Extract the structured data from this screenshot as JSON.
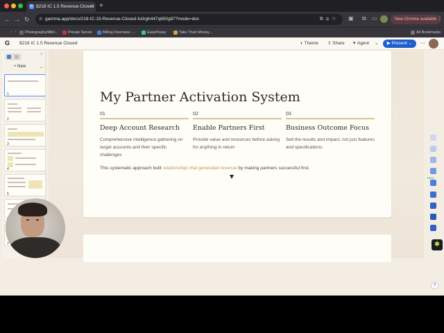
{
  "browser": {
    "tab_title": "$218 IC 1.5 Revenue Closed",
    "new_tab_symbol": "+",
    "url": "gamma.app/docs/218-IC-15-Revenue-Closed-fu0rgh447q650g87?mode=doc",
    "new_chrome_badge": "New Chrome available",
    "bookmarks": [
      "Photography/Mkti...",
      "Private Server",
      "Billing Overview -...",
      "EasyPeasy",
      "Take Their Money...",
      "All Bookmarks"
    ]
  },
  "app": {
    "doc_title": "$218 IC 1.5 Revenue Closed",
    "header": {
      "theme": "Theme",
      "share": "Share",
      "agent": "Agent",
      "present": "Present"
    }
  },
  "left_panel": {
    "new_label": "New",
    "thumbnails": [
      "1",
      "2",
      "3",
      "4",
      "5",
      "6",
      "7"
    ]
  },
  "page": {
    "title": "My Partner Activation System",
    "columns": [
      {
        "num": "01",
        "heading": "Deep Account Research",
        "body": "Comprehensive intelligence gathering on target accounts and their specific challenges"
      },
      {
        "num": "02",
        "heading": "Enable Partners First",
        "body": "Provide value and resources before asking for anything in return"
      },
      {
        "num": "03",
        "heading": "Business Outcome Focus",
        "body": "Sell the results and impact, not just features and specifications"
      }
    ],
    "summary_pre": "This systematic approach built ",
    "summary_highlight": "relationships that generated revenue",
    "summary_post": " by making partners successful first."
  },
  "right_toolbar": {
    "new_badge": "NEW",
    "help": "?"
  },
  "colors": {
    "accent_gold": "#b99a4c",
    "present_blue": "#1f5fcc",
    "card_bg": "#fffdf8"
  }
}
